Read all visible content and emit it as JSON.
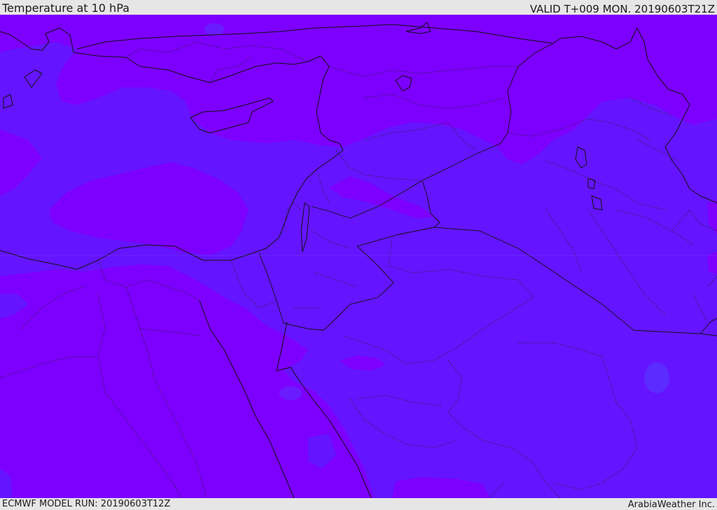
{
  "header": {
    "title": "Temperature at 10 hPa",
    "valid": "VALID T+009 MON. 20190603T21Z"
  },
  "footer": {
    "model_run": "ECMWF MODEL RUN: 20190603T12Z",
    "credit": "ArabiaWeather Inc."
  },
  "colors": {
    "band_warm": "#7d00ff",
    "band_cool": "#6514ff",
    "lines": "#111111",
    "chrome": "#e6e6e6"
  }
}
